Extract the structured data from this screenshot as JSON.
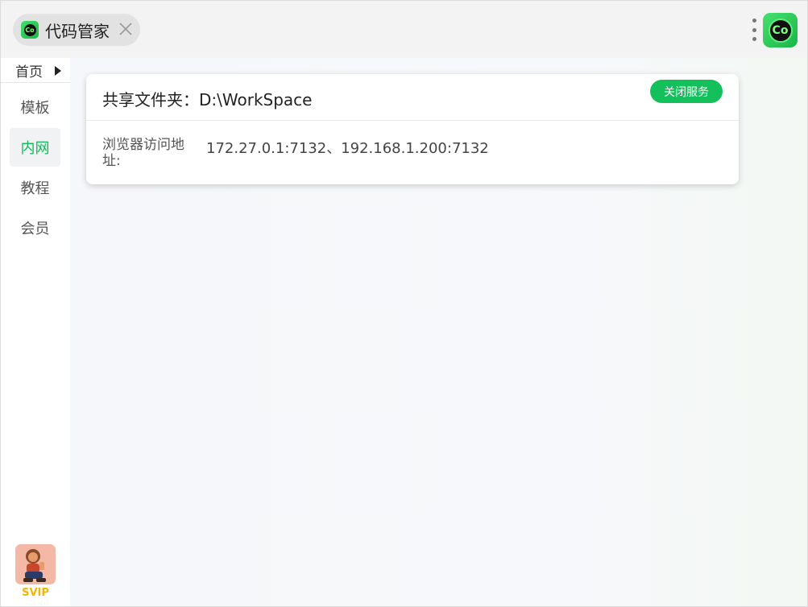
{
  "titlebar": {
    "tab": {
      "icon_text": "Co",
      "title": "代码管家"
    },
    "app_logo_text": "Co"
  },
  "sidebar": {
    "home_label": "首页",
    "items": [
      {
        "label": "模板",
        "active": false
      },
      {
        "label": "内网",
        "active": true
      },
      {
        "label": "教程",
        "active": false
      },
      {
        "label": "会员",
        "active": false
      }
    ],
    "svip_label": "SVIP"
  },
  "main": {
    "card": {
      "folder_label": "共享文件夹：D:\\WorkSpace",
      "close_service_label": "关闭服务",
      "address_label": "浏览器访问地址:",
      "address_value": "172.27.0.1:7132、192.168.1.200:7132"
    }
  },
  "colors": {
    "accent_green": "#13c05c",
    "active_nav_text": "#13b85a",
    "svip_gold": "#f2b705"
  }
}
